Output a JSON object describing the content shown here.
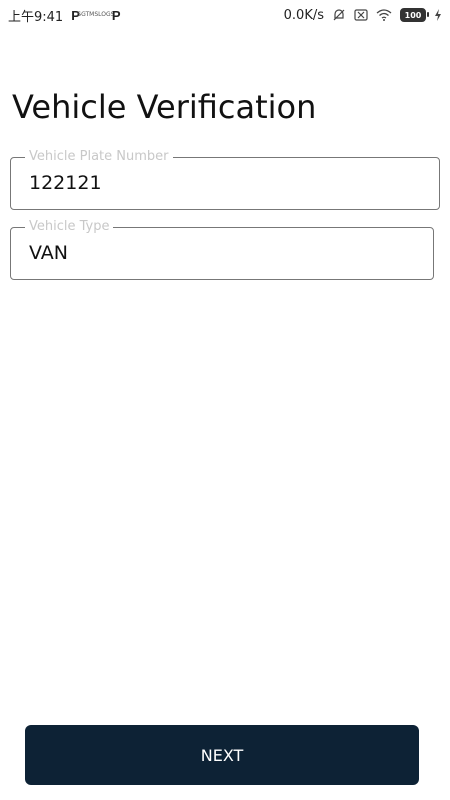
{
  "status_bar": {
    "time": "上午9:41",
    "app_icon_1": "P",
    "app_icon_2_lines": [
      "SGTMS",
      "LOGS"
    ],
    "app_icon_3": "P",
    "net_speed": "0.0K/s",
    "battery_level": "100",
    "icons": [
      "notification-muted-icon",
      "sim-blocked-icon",
      "wifi-icon",
      "battery-icon",
      "charging-icon"
    ]
  },
  "page": {
    "title": "Vehicle Verification"
  },
  "form": {
    "plate": {
      "label": "Vehicle Plate Number",
      "value": "122121"
    },
    "type": {
      "label": "Vehicle Type",
      "value": "VAN"
    }
  },
  "actions": {
    "next_label": "NEXT"
  },
  "colors": {
    "button_bg": "#0d2235",
    "label": "#c8c8c8",
    "border": "#777777"
  }
}
